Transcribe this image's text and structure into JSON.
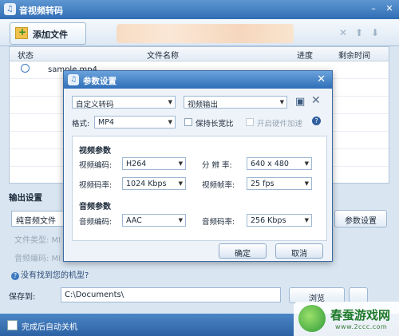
{
  "window": {
    "title": "音视频转码"
  },
  "toolbar": {
    "add_file_label": "添加文件"
  },
  "table": {
    "headers": {
      "status": "状态",
      "filename": "文件名称",
      "progress": "进度",
      "remaining": "剩余时间"
    },
    "rows": [
      {
        "filename": "sample.mp4"
      }
    ]
  },
  "output": {
    "section_label": "输出设置",
    "format_value": "纯音频文件",
    "file_type_label": "文件类型: MI",
    "audio_codec_label": "音频编码: MI",
    "param_button": "参数设置",
    "help_link": "没有找到您的机型?",
    "save_to_label": "保存到:",
    "save_path": "C:\\Documents\\",
    "browse_button": "浏览"
  },
  "status_bar": {
    "auto_shutdown_label": "完成后自动关机"
  },
  "watermark": {
    "brand": "春蚕游戏网",
    "url": "www.2ccc.com"
  },
  "dialog": {
    "title": "参数设置",
    "preset_value": "自定义转码",
    "output_type_value": "视频输出",
    "format_label": "格式:",
    "format_value": "MP4",
    "keep_ratio_label": "保持长宽比",
    "hw_accel_label": "开启硬件加速",
    "video_section": "视频参数",
    "video_codec_label": "视频编码:",
    "video_codec_value": "H264",
    "resolution_label": "分 辨 率:",
    "resolution_value": "640 x 480",
    "video_bitrate_label": "视频码率:",
    "video_bitrate_value": "1024 Kbps",
    "framerate_label": "视频帧率:",
    "framerate_value": "25 fps",
    "audio_section": "音频参数",
    "audio_codec_label": "音频编码:",
    "audio_codec_value": "AAC",
    "audio_bitrate_label": "音频码率:",
    "audio_bitrate_value": "256 Kbps",
    "ok_button": "确定",
    "cancel_button": "取消"
  }
}
